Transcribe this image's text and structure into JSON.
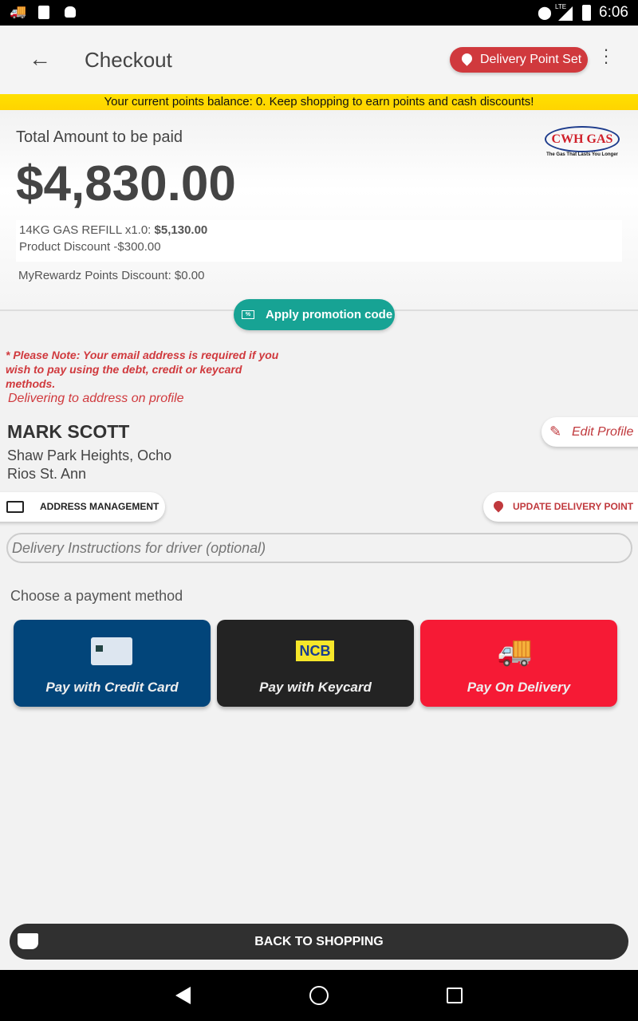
{
  "status_bar": {
    "time": "6:06",
    "network": "LTE"
  },
  "app_bar": {
    "title": "Checkout",
    "delivery_point_label": "Delivery Point Set"
  },
  "banner": "Your current points balance: 0. Keep shopping to earn points and cash discounts!",
  "summary": {
    "total_label": "Total Amount to be paid",
    "total": "$4,830.00",
    "item": "14KG GAS REFILL  x1.0:",
    "item_price": "$5,130.00",
    "discount": "Product Discount -$300.00",
    "points_discount": "MyRewardz Points Discount: $0.00",
    "logo_text": "CWH GAS",
    "logo_tagline": "The Gas That Lasts You Longer"
  },
  "promo_button": "Apply promotion code",
  "note": "* Please Note: Your email address is required if you wish to pay using the debt, credit or keycard methods.",
  "delivering_label": "Delivering to address on profile",
  "customer": {
    "name": "MARK SCOTT",
    "address": "Shaw Park Heights, Ocho Rios St. Ann"
  },
  "edit_profile": "Edit Profile",
  "address_management": "ADDRESS MANAGEMENT",
  "update_delivery_point": "UPDATE DELIVERY POINT",
  "instructions_placeholder": "Delivery Instructions for driver (optional)",
  "payment_heading": "Choose a payment method",
  "payment_methods": [
    {
      "label": "Pay with Credit Card",
      "color": "#02457a"
    },
    {
      "label": "Pay with Keycard",
      "color": "#232323"
    },
    {
      "label": "Pay On Delivery",
      "color": "#f61a35"
    }
  ],
  "back_to_shopping": "BACK TO SHOPPING",
  "colors": {
    "accent_red": "#d0393d",
    "teal": "#17a394",
    "banner_yellow": "#ffd800"
  }
}
